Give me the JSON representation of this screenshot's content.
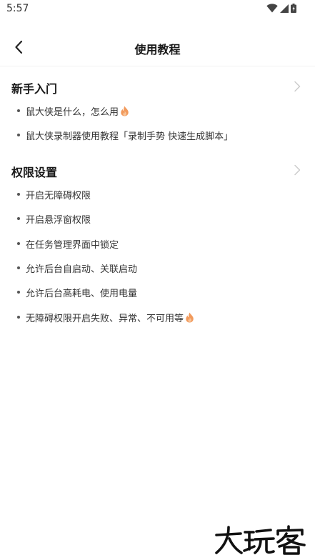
{
  "status_bar": {
    "time": "5:57",
    "icons": [
      "wifi-icon",
      "signal-icon",
      "battery-icon"
    ]
  },
  "nav": {
    "title": "使用教程",
    "back_icon": "chevron-left-icon"
  },
  "sections": [
    {
      "title": "新手入门",
      "items": [
        {
          "label": "鼠大侠是什么，怎么用",
          "hot": true
        },
        {
          "label": "鼠大侠录制器使用教程「录制手势 快速生成脚本」",
          "hot": false
        }
      ]
    },
    {
      "title": "权限设置",
      "items": [
        {
          "label": "开启无障碍权限",
          "hot": false
        },
        {
          "label": "开启悬浮窗权限",
          "hot": false
        },
        {
          "label": "在任务管理界面中锁定",
          "hot": false
        },
        {
          "label": "允许后台自启动、关联启动",
          "hot": false
        },
        {
          "label": "允许后台高耗电、使用电量",
          "hot": false
        },
        {
          "label": "无障碍权限开启失败、异常、不可用等",
          "hot": true
        }
      ]
    }
  ],
  "watermark": {
    "text": "大玩客"
  },
  "colors": {
    "fire_outer": "#f29a5c",
    "fire_inner": "#f7c59a",
    "chevron": "#cccccc"
  }
}
